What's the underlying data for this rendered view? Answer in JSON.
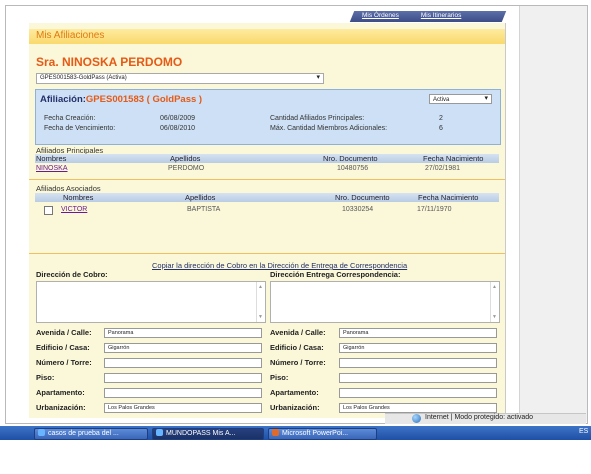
{
  "nav": {
    "links": [
      "Mis Órdenes",
      "Mis Itinerarios"
    ]
  },
  "header": {
    "title": "Mis Afiliaciones"
  },
  "client": {
    "name": "Sra. NINOSKA PERDOMO"
  },
  "affiliation_select": {
    "value": "GPES001583-GoldPass (Activa)"
  },
  "affiliation": {
    "label": "Afiliación:",
    "code": "GPES001583 ( GoldPass )",
    "status": "Activa",
    "created_label": "Fecha Creación:",
    "created_value": "06/08/2009",
    "expiry_label": "Fecha de Vencimiento:",
    "expiry_value": "06/08/2010",
    "principal_count_label": "Cantidad Afiliados Principales:",
    "principal_count_value": "2",
    "max_additional_label": "Máx. Cantidad Miembros Adicionales:",
    "max_additional_value": "6"
  },
  "principals": {
    "title": "Afiliados Principales",
    "headers": [
      "Nombres",
      "Apellidos",
      "Nro. Documento",
      "Fecha Nacimiento"
    ],
    "rows": [
      {
        "name": "NINOSKA",
        "surname": "PERDOMO",
        "doc": "10480756",
        "dob": "27/02/1981"
      }
    ]
  },
  "associates": {
    "title": "Afiliados Asociados",
    "headers": [
      "Nombres",
      "Apellidos",
      "Nro. Documento",
      "Fecha Nacimiento"
    ],
    "rows": [
      {
        "name": "VICTOR",
        "surname": "BAPTISTA",
        "doc": "10330254",
        "dob": "17/11/1970"
      }
    ]
  },
  "address": {
    "copy_link": "Copiar la dirección de Cobro en la Dirección de Entrega de Correspondencia",
    "billing_label": "Dirección de Cobro:",
    "delivery_label": "Dirección Entrega Correspondencia:",
    "fields": [
      {
        "label": "Avenida / Calle:",
        "left": "Panorama",
        "right": "Panorama"
      },
      {
        "label": "Edificio / Casa:",
        "left": "Gigarrón",
        "right": "Gigarrón"
      },
      {
        "label": "Número / Torre:",
        "left": "",
        "right": ""
      },
      {
        "label": "Piso:",
        "left": "",
        "right": ""
      },
      {
        "label": "Apartamento:",
        "left": "",
        "right": ""
      },
      {
        "label": "Urbanización:",
        "left": "Los Palos Grandes",
        "right": "Los Palos Grandes"
      }
    ]
  },
  "statusbar": {
    "text": "Internet | Modo protegido: activado"
  },
  "taskbar": {
    "items": [
      "casos de prueba del ...",
      "MUNDOPASS Mis A...",
      "Microsoft PowerPoi..."
    ],
    "tray": "ES"
  }
}
